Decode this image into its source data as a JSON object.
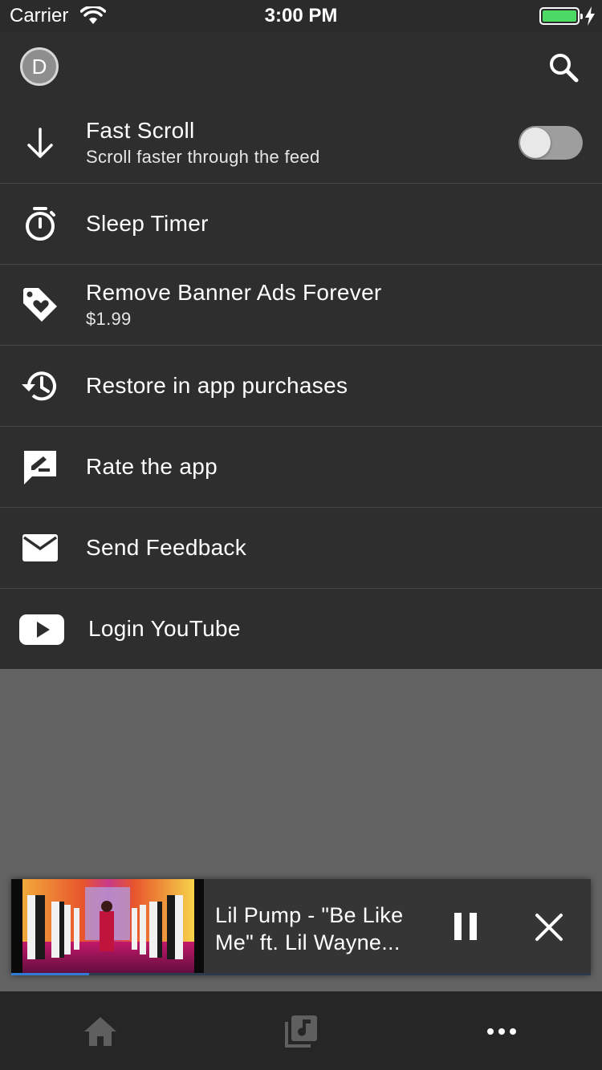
{
  "status_bar": {
    "carrier": "Carrier",
    "time": "3:00 PM",
    "battery_color": "#4cd964"
  },
  "header": {
    "avatar_letter": "D",
    "search_icon": "search-icon"
  },
  "menu": {
    "items": [
      {
        "icon": "arrow-down-icon",
        "label": "Fast Scroll",
        "sub": "Scroll faster through the feed",
        "toggle_on": false
      },
      {
        "icon": "timer-icon",
        "label": "Sleep Timer"
      },
      {
        "icon": "tag-heart-icon",
        "label": "Remove Banner Ads Forever",
        "sub": "$1.99"
      },
      {
        "icon": "history-icon",
        "label": "Restore in app purchases"
      },
      {
        "icon": "rate-review-icon",
        "label": "Rate the app"
      },
      {
        "icon": "mail-icon",
        "label": "Send Feedback"
      },
      {
        "icon": "youtube-icon",
        "label": "Login YouTube"
      }
    ]
  },
  "player": {
    "title": "Lil Pump - \"Be Like Me\" ft. Lil Wayne...",
    "progress": 0.135,
    "accent": "#2f7bd6"
  },
  "tabs": [
    {
      "icon": "home-icon"
    },
    {
      "icon": "music-library-icon"
    },
    {
      "icon": "more-icon"
    }
  ]
}
